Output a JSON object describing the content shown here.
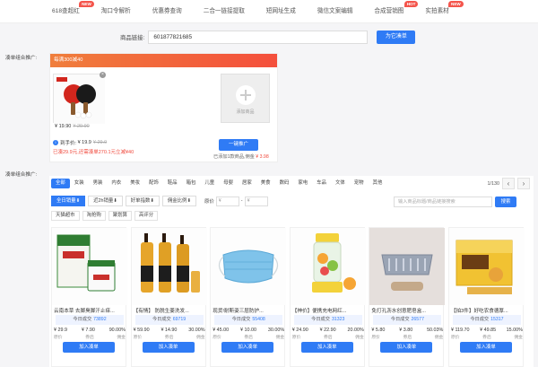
{
  "nav": [
    {
      "label": "618查超红",
      "badge": "NEW"
    },
    {
      "label": "淘口令解析"
    },
    {
      "label": "优惠券查询"
    },
    {
      "label": "二合一链接提取"
    },
    {
      "label": "短网址生成"
    },
    {
      "label": "微信文案编辑"
    },
    {
      "label": "合成营销图",
      "badge": "HOT"
    },
    {
      "label": "实拍素材",
      "badge": "NEW"
    }
  ],
  "link_input": {
    "label": "商品链接:",
    "value": "601877821685",
    "button": "为它凑单"
  },
  "combo": {
    "section_label": "凑单组合推广:",
    "banner": "每满300减40",
    "product_price": "¥ 19.90",
    "product_original": "¥ 29.90",
    "add_label": "添加商品",
    "arrive_label": "到手价:",
    "arrive_price": "¥ 19.9",
    "arrive_original": "¥ 29.9",
    "tip": "已凑29.9元,还需凑单270.1元立减¥40",
    "button": "一键推广",
    "note_prefix": "已添加1款商品,佣金",
    "note_value": "¥ 3.98"
  },
  "list": {
    "section_label": "凑单组合推广:",
    "categories": [
      "全部",
      "女装",
      "男装",
      "内衣",
      "美妆",
      "配饰",
      "鞋品",
      "箱包",
      "儿童",
      "母婴",
      "居家",
      "美食",
      "数码",
      "家电",
      "车品",
      "文体",
      "宠物",
      "其他"
    ],
    "page": "1/130",
    "sorts": [
      "全日销量⬇",
      "近2h销量⬇",
      "好单指数⬇",
      "佣金比例⬇"
    ],
    "price_label": "原价",
    "price_min_placeholder": "¥",
    "price_sep": "-",
    "price_max_placeholder": "¥",
    "search_placeholder": "输入商品标题/商品链接搜索",
    "search_button": "搜索",
    "tags": [
      "天猫超市",
      "淘抢购",
      "聚划算",
      "高评分"
    ],
    "sales_prefix": "今日成交",
    "price_labels": [
      "原价",
      "券后",
      "佣金"
    ],
    "join_label": "加入凑单",
    "products": [
      {
        "title": "云南本草 去脚臭脚汗止痒...",
        "sales": "73892",
        "orig": "¥ 29.9",
        "after": "¥ 7.90",
        "comm": "90.00%"
      },
      {
        "title": "【有情】 防脱生姜洗发...",
        "sales": "69719",
        "orig": "¥ 59.90",
        "after": "¥ 14.90",
        "comm": "30.00%"
      },
      {
        "title": "现货!耐斯姿三层防护...",
        "sales": "55408",
        "orig": "¥ 45.00",
        "after": "¥ 10.00",
        "comm": "30.00%"
      },
      {
        "title": "【神价】便携充电网红...",
        "sales": "31323",
        "orig": "¥ 24.90",
        "after": "¥ 22.90",
        "comm": "20.00%"
      },
      {
        "title": "免打孔沥水创意肥皂盒...",
        "sales": "26577",
        "orig": "¥ 5.80",
        "after": "¥ 3.80",
        "comm": "50.03%"
      },
      {
        "title": "【拍3件】好吃农食德厚...",
        "sales": "15317",
        "orig": "¥ 119.70",
        "after": "¥ 49.85",
        "comm": "15.00%"
      }
    ]
  },
  "colors": {
    "accent": "#2f7bf5",
    "banner_start": "#f07e3c",
    "banner_end": "#f44f3c",
    "warning": "#f0493c",
    "badge": "#f4554c"
  }
}
